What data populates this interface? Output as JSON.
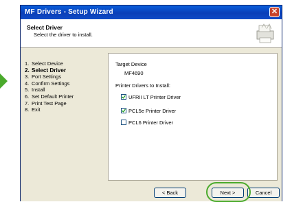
{
  "window": {
    "title": "MF Drivers - Setup Wizard",
    "close_glyph": "✕"
  },
  "header": {
    "title": "Select Driver",
    "subtitle": "Select the driver to install."
  },
  "steps": [
    {
      "num": "1.",
      "label": "Select Device"
    },
    {
      "num": "2.",
      "label": "Select Driver"
    },
    {
      "num": "3.",
      "label": "Port Settings"
    },
    {
      "num": "4.",
      "label": "Confirm Settings"
    },
    {
      "num": "5.",
      "label": "Install"
    },
    {
      "num": "6.",
      "label": "Set Default Printer"
    },
    {
      "num": "7.",
      "label": "Print Test Page"
    },
    {
      "num": "8.",
      "label": "Exit"
    }
  ],
  "active_step": "Select Driver",
  "main": {
    "target_label": "Target Device",
    "target_value": "MF4690",
    "drivers_label": "Printer Drivers to Install:",
    "drivers": [
      {
        "label": "UFRII LT Printer Driver",
        "checked": true
      },
      {
        "label": "PCL5e Printer Driver",
        "checked": true
      },
      {
        "label": "PCL6 Printer Driver",
        "checked": false
      }
    ]
  },
  "buttons": {
    "back": "< Back",
    "next": "Next >",
    "cancel": "Cancel"
  },
  "colors": {
    "titlebar": "#0a4fd0",
    "highlight": "#4aaa2c",
    "dialog_bg": "#ece9d8"
  },
  "icons": {
    "arrow": "pointer-arrow-icon",
    "wizard": "printer-wizard-icon",
    "close": "close-icon",
    "check": "checkmark-icon"
  }
}
